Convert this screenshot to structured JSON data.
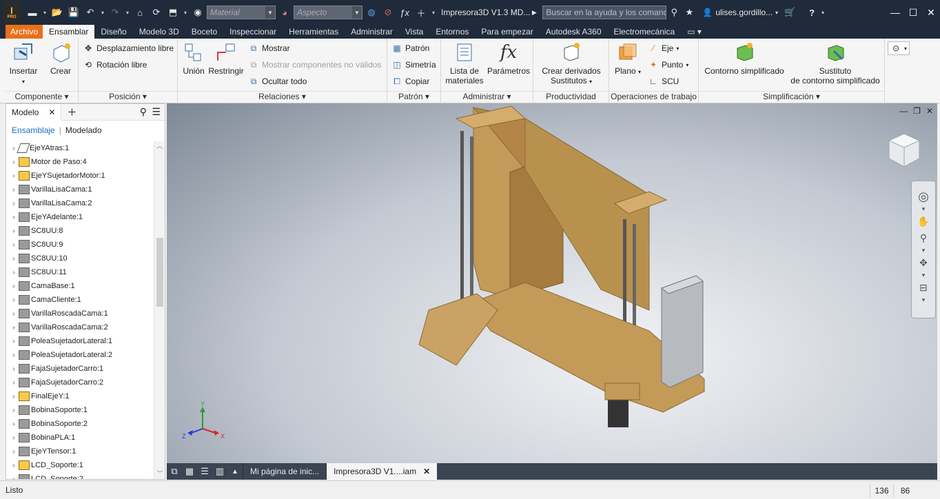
{
  "titlebar": {
    "logo_text": "I",
    "logo_sub": "PRO",
    "material_placeholder": "Material",
    "aspect_placeholder": "Aspecto",
    "doc_title": "Impresora3D V1.3 MD...",
    "search_placeholder": "Buscar en la ayuda y los comand",
    "user_name": "ulises.gordillo...",
    "help_label": "?"
  },
  "menu": {
    "tabs": [
      "Archivo",
      "Ensamblar",
      "Diseño",
      "Modelo 3D",
      "Boceto",
      "Inspeccionar",
      "Herramientas",
      "Administrar",
      "Vista",
      "Entornos",
      "Para empezar",
      "Autodesk A360",
      "Electromecánica"
    ],
    "active_tab": "Ensamblar"
  },
  "ribbon": {
    "componente": {
      "title": "Componente",
      "insertar": "Insertar",
      "crear": "Crear"
    },
    "posicion": {
      "title": "Posición",
      "desplazamiento": "Desplazamiento libre",
      "rotacion": "Rotación libre"
    },
    "relaciones": {
      "title": "Relaciones",
      "union": "Unión",
      "restringir": "Restringir",
      "mostrar": "Mostrar",
      "mostrar_no_validos": "Mostrar componentes no válidos",
      "ocultar_todo": "Ocultar todo"
    },
    "patron": {
      "title": "Patrón",
      "patron": "Patrón",
      "simetria": "Simetría",
      "copiar": "Copiar"
    },
    "administrar": {
      "title": "Administrar",
      "lista_line1": "Lista de",
      "lista_line2": "materiales",
      "parametros": "Parámetros",
      "fx_symbol": "fx"
    },
    "productividad": {
      "title": "Productividad",
      "crear_line1": "Crear derivados",
      "crear_line2": "Sustitutos"
    },
    "operaciones": {
      "title": "Operaciones de trabajo",
      "plano": "Plano",
      "eje": "Eje",
      "punto": "Punto",
      "scu": "SCU"
    },
    "simplificacion": {
      "title": "Simplificación",
      "contorno": "Contorno simplificado",
      "sustituto_line1": "Sustituto",
      "sustituto_line2": "de contorno simplificado"
    }
  },
  "browser": {
    "tab_label": "Modelo",
    "sub_ensamblaje": "Ensamblaje",
    "sub_modelado": "Modelado",
    "items": [
      {
        "label": "EjeYAtras:1",
        "icon": "w"
      },
      {
        "label": "Motor de Paso:4",
        "icon": "y"
      },
      {
        "label": "EjeYSujetadorMotor:1",
        "icon": "y"
      },
      {
        "label": "VarillaLisaCama:1",
        "icon": "g"
      },
      {
        "label": "VarillaLisaCama:2",
        "icon": "g"
      },
      {
        "label": "EjeYAdelante:1",
        "icon": "g"
      },
      {
        "label": "SC8UU:8",
        "icon": "g"
      },
      {
        "label": "SC8UU:9",
        "icon": "g"
      },
      {
        "label": "SC8UU:10",
        "icon": "g"
      },
      {
        "label": "SC8UU:11",
        "icon": "g"
      },
      {
        "label": "CamaBase:1",
        "icon": "g"
      },
      {
        "label": "CamaCliente:1",
        "icon": "g"
      },
      {
        "label": "VarillaRoscadaCama:1",
        "icon": "g"
      },
      {
        "label": "VarillaRoscadaCama:2",
        "icon": "g"
      },
      {
        "label": "PoleaSujetadorLateral:1",
        "icon": "g"
      },
      {
        "label": "PoleaSujetadorLateral:2",
        "icon": "g"
      },
      {
        "label": "FajaSujetadorCarro:1",
        "icon": "g"
      },
      {
        "label": "FajaSujetadorCarro:2",
        "icon": "g"
      },
      {
        "label": "FinalEjeY:1",
        "icon": "y"
      },
      {
        "label": "BobinaSoporte:1",
        "icon": "g"
      },
      {
        "label": "BobinaSoporte:2",
        "icon": "g"
      },
      {
        "label": "BobinaPLA:1",
        "icon": "g"
      },
      {
        "label": "EjeYTensor:1",
        "icon": "g"
      },
      {
        "label": "LCD_Soporte:1",
        "icon": "y"
      },
      {
        "label": "LCD_Soporte:2",
        "icon": "g"
      }
    ]
  },
  "viewport": {
    "triad_y": "Y",
    "triad_x": "X",
    "triad_z": "Z"
  },
  "doc_tabs": {
    "home": "Mi página de inic...",
    "active": "Impresora3D V1....iam"
  },
  "status": {
    "text": "Listo",
    "coord_x": "136",
    "coord_y": "86"
  },
  "colors": {
    "titlebar_bg": "#1f2a3a",
    "archivo_tab": "#e8701a",
    "wood": "#b8914f",
    "link_blue": "#1a6fc6"
  }
}
